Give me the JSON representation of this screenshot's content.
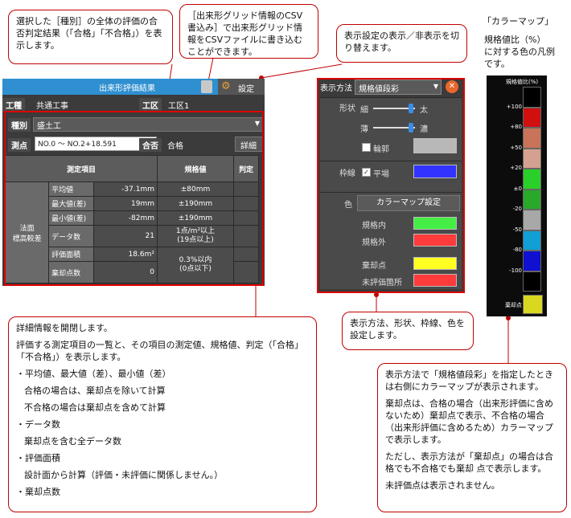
{
  "callouts": {
    "judge": "選択した［種別］の全体の評価の合否判定結果（「合格」「不合格」）を表示します。",
    "csv": "［出来形グリッド情報のCSV書込み］で出来形グリッド情報をCSVファイルに書き込むことができます。",
    "toggle": "表示設定の表示／非表示を切り替えます。",
    "detail": {
      "l1": "詳細情報を開閉します。",
      "l2": "評価する測定項目の一覧と、その項目の測定値、規格値、判定（「合格」「不合格」）を表示します。",
      "l3": "・平均値、最大値（差）、最小値（差）",
      "l4": "合格の場合は、棄却点を除いて計算",
      "l5": "不合格の場合は棄却点を含めて計算",
      "l6": "・データ数",
      "l7": "棄却点を含む全データ数",
      "l8": "・評価面積",
      "l9": "設計面から計算（評価・未評価に関係しません。）",
      "l10": "・棄却点数"
    },
    "settings": "表示方法、形状、枠線、色を設定します。",
    "colormap_note": {
      "p1": "表示方法で「規格値段彩」を指定したときは右側にカラーマップが表示されます。",
      "p2": "棄却点は、合格の場合（出来形評価に含めないため）棄却点で表示、不合格の場合（出来形評価に含めるため）カラーマップで表示します。",
      "p3": "ただし、表示方法が「棄却点」の場合は合格でも不合格でも棄却 点で表示します。",
      "p4": "未評価点は表示されません。"
    }
  },
  "panel": {
    "title": "出来形評価結果",
    "settings_label": "設定",
    "koshu_label": "工種",
    "koshu_value": "共通工事",
    "ku_label": "工区",
    "ku_value": "工区1",
    "shubetsu_label": "種別",
    "shubetsu_value": "盛土工",
    "sokuten_label": "測点",
    "sokuten_value": "NO.0 〜 NO.2+18.591",
    "gohi_label": "合否",
    "gohi_value": "合格",
    "detail_button": "詳細",
    "table": {
      "headers": [
        "測定項目",
        "規格値",
        "判定"
      ],
      "category": "法面\n標高較差",
      "rows": [
        {
          "item": "平均値",
          "value": "-37.1mm",
          "std": "±80mm"
        },
        {
          "item": "最大値(差)",
          "value": "19mm",
          "std": "±190mm"
        },
        {
          "item": "最小値(差)",
          "value": "-82mm",
          "std": "±190mm"
        },
        {
          "item": "データ数",
          "value": "21",
          "std": "1点/m²以上\n(19点以上)"
        },
        {
          "item": "評価面積",
          "value": "18.6m²",
          "std": ""
        },
        {
          "item": "棄却点数",
          "value": "0",
          "std": "0.3%以内\n(0点以下)"
        }
      ]
    }
  },
  "display": {
    "mode_label": "表示方法",
    "mode_value": "規格値段彩",
    "shape_label": "形状",
    "thin": "細",
    "thick": "太",
    "light": "薄",
    "dark": "濃",
    "outline": "輪郭",
    "frame_label": "枠線",
    "flat": "平場",
    "color_label": "色",
    "colormap_button": "カラーマップ設定",
    "in_spec": "規格内",
    "out_spec": "規格外",
    "rejected": "棄却点",
    "unevaluated": "未評価箇所",
    "colors": {
      "outline": "#b8b8b8",
      "flat": "#3333ff",
      "in_spec": "#44ee44",
      "out_spec": "#ff3b3b",
      "rejected": "#ffff22",
      "unevaluated": "#ff3b3b"
    }
  },
  "colormap": {
    "title": "「カラーマップ」",
    "desc": "規格値比（%）\nに対する色の凡例\nです。",
    "header": "規格値比(%)",
    "labels": [
      "+100",
      "+80",
      "+50",
      "+20",
      "±0",
      "-20",
      "-50",
      "-80",
      "-100"
    ],
    "colors": [
      "#000000",
      "#d10f0f",
      "#c8735a",
      "#d4a190",
      "#2ad02a",
      "#2aa82a",
      "#a8a8a8",
      "#119fd6",
      "#1010d0",
      "#000000"
    ],
    "rejected_label": "棄却点",
    "rejected_color": "#d8d820"
  }
}
